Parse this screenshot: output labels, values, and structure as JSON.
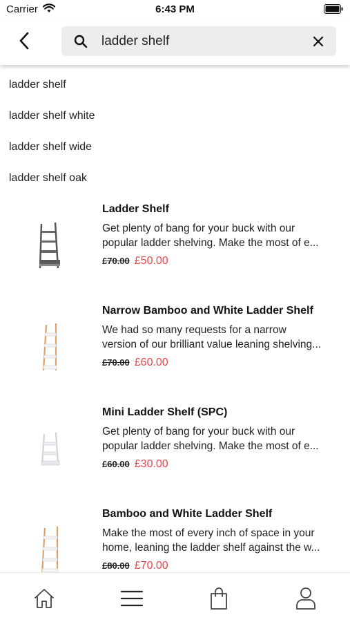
{
  "status_bar": {
    "carrier": "Carrier",
    "time": "6:43 PM"
  },
  "search": {
    "query": "ladder shelf",
    "placeholder": ""
  },
  "suggestions": [
    "ladder shelf",
    "ladder shelf white",
    "ladder shelf wide",
    "ladder shelf oak"
  ],
  "products": [
    {
      "title": "Ladder Shelf",
      "desc_line1": "Get plenty of bang for your buck with our",
      "desc_line2": "popular ladder shelving. Make the most of e...",
      "old_price": "£70.00",
      "new_price": "£50.00",
      "image": "grey-ladder-shelf"
    },
    {
      "title": "Narrow Bamboo and White Ladder Shelf",
      "desc_line1": "We had so many requests for a narrow",
      "desc_line2": "version of our brilliant value leaning shelving...",
      "old_price": "£70.00",
      "new_price": "£60.00",
      "image": "bamboo-white-ladder-shelf"
    },
    {
      "title": "Mini Ladder Shelf (SPC)",
      "desc_line1": "Get plenty of bang for your buck with our",
      "desc_line2": "popular ladder shelving. Make the most of e...",
      "old_price": "£60.00",
      "new_price": "£30.00",
      "image": "white-mini-ladder-shelf"
    },
    {
      "title": "Bamboo and White Ladder Shelf",
      "desc_line1": "Make the most of every inch of space in your",
      "desc_line2": "home, leaning the ladder shelf against the w...",
      "old_price": "£80.00",
      "new_price": "£70.00",
      "image": "bamboo-white-ladder-shelf"
    }
  ],
  "bottom_nav": [
    "home-icon",
    "menu-icon",
    "bag-icon",
    "account-icon"
  ],
  "colors": {
    "sale_price": "#e8474c",
    "search_bg": "#ededed"
  }
}
